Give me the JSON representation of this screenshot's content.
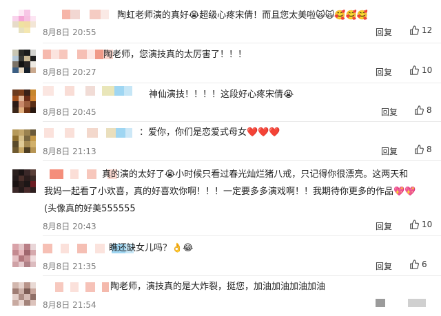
{
  "comments": [
    {
      "text": "陶虹老师演的真好😭超级心疼宋倩！而且您太美啦🙀🙀🥰🥰🥰",
      "time": "8月8日 20:55",
      "reply": "回复",
      "likes": "12"
    },
    {
      "text": "陶老师，您演技真的太厉害了！！！",
      "time": "8月8日 20:27",
      "reply": "回复",
      "likes": "10"
    },
    {
      "text": "神仙演技！！！！这段好心疼宋倩😭",
      "time": "8月8日 20:45",
      "reply": "回复",
      "likes": "8"
    },
    {
      "text": "：爱你，你们是恋爱式母女❤️❤️❤️",
      "time": "8月8日 21:13",
      "reply": "回复",
      "likes": "8"
    },
    {
      "text_line1": "真的演的太好了😭小时候只看过春光灿烂猪八戒，只记得你很漂亮。这两天和",
      "text_line2": "我妈一起看了小欢喜，真的好喜欢你啊！！！一定要多多演戏啊！！我期待你更多的作品💖💖",
      "text_line3": "(头像真的好美555555",
      "time": "8月8日 20:43",
      "reply": "回复",
      "likes": "10"
    },
    {
      "text": "瞧还缺女儿吗？👌😂",
      "time": "8月8日 21:35",
      "reply": "回复",
      "likes": "6"
    },
    {
      "text": "陶老师，演技真的是大炸裂，挺您，加油加油加油加油",
      "time": "8月8日 21:54",
      "reply": "",
      "likes": ""
    }
  ],
  "colors": {
    "text": "#222222",
    "time": "#7c7c7c",
    "divider": "#ebebeb"
  },
  "icons": {
    "like": "thumbs-up-icon"
  }
}
